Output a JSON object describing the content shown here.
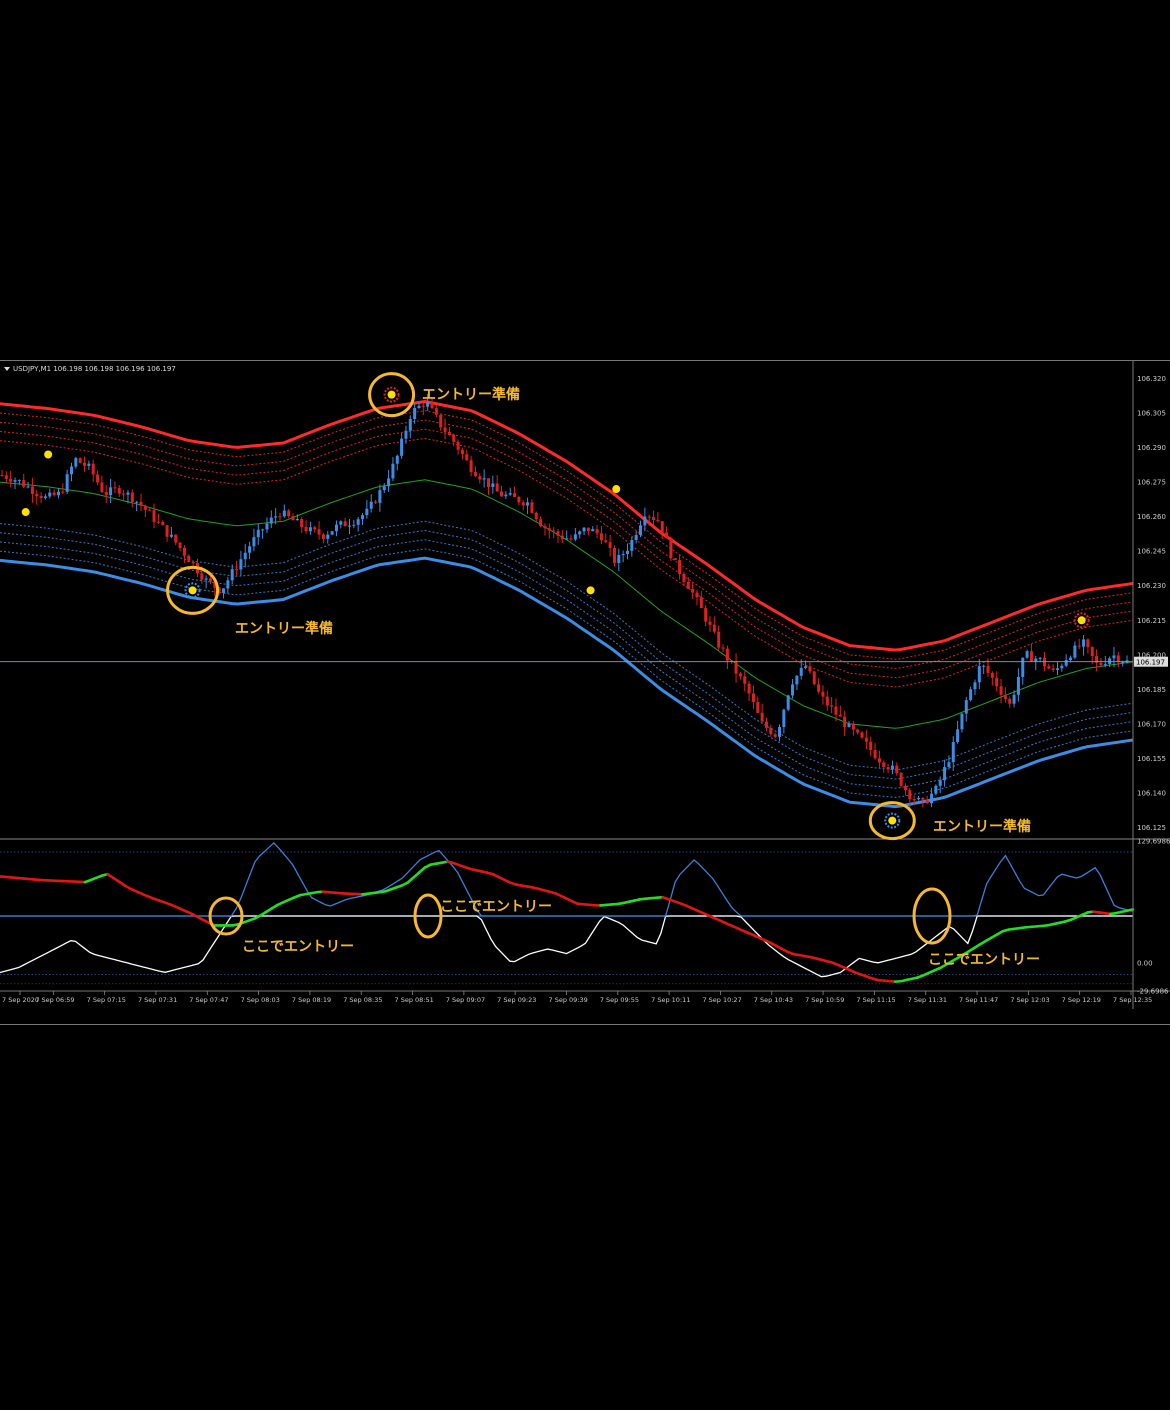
{
  "window": {
    "symbol": "USDJPY,M1",
    "ohlc": "106.198 106.198 106.196 106.197"
  },
  "colors": {
    "up": "#3a8ee6",
    "down": "#e02020",
    "band_upper": "#ff2a2a",
    "band_lower": "#3a8ee6",
    "midline": "#1fa11f",
    "signal_dot": "#ffe000",
    "annotation": "#f5b82e",
    "osc_white": "#ffffff",
    "osc_blue": "#3a7fd8",
    "osc_green": "#22dd22",
    "osc_red": "#e01515"
  },
  "chart_data": [
    {
      "type": "candlestick",
      "symbol": "USDJPY",
      "timeframe": "M1",
      "price_axis_labels": [
        "106.320",
        "106.305",
        "106.290",
        "106.275",
        "106.260",
        "106.245",
        "106.230",
        "106.215",
        "106.200",
        "106.185",
        "106.170",
        "106.155",
        "106.140",
        "106.125"
      ],
      "current_price": "106.197",
      "ylim": [
        106.12,
        106.325
      ],
      "annotations": [
        "エントリー準備",
        "エントリー準備",
        "エントリー準備"
      ],
      "signal_dots": [
        {
          "time": "06:55",
          "price": 106.262,
          "kind": "yellow"
        },
        {
          "time": "07:02",
          "price": 106.287,
          "kind": "yellow"
        },
        {
          "time": "07:47",
          "price": 106.228,
          "kind": "buy"
        },
        {
          "time": "08:49",
          "price": 106.313,
          "kind": "sell"
        },
        {
          "time": "09:51",
          "price": 106.228,
          "kind": "yellow"
        },
        {
          "time": "09:59",
          "price": 106.272,
          "kind": "yellow"
        },
        {
          "time": "11:25",
          "price": 106.128,
          "kind": "buy"
        },
        {
          "time": "12:24",
          "price": 106.215,
          "kind": "sell"
        }
      ],
      "series": [
        {
          "name": "close",
          "values": [
            106.278,
            106.276,
            106.272,
            106.268,
            106.27,
            106.285,
            106.281,
            106.27,
            106.272,
            106.268,
            106.262,
            106.255,
            106.248,
            106.24,
            106.232,
            106.228,
            106.238,
            106.248,
            106.256,
            106.262,
            106.258,
            106.254,
            106.252,
            106.256,
            106.258,
            106.262,
            106.272,
            106.285,
            106.305,
            106.31,
            106.3,
            106.292,
            106.282,
            106.276,
            106.27,
            106.268,
            106.266,
            106.256,
            106.252,
            106.25,
            106.255,
            106.252,
            106.24,
            106.248,
            106.262,
            106.258,
            106.24,
            106.23,
            106.218,
            106.205,
            106.195,
            106.185,
            106.17,
            106.165,
            106.188,
            106.195,
            106.182,
            106.175,
            106.168,
            106.162,
            106.155,
            106.15,
            106.14,
            106.135,
            106.142,
            106.158,
            106.18,
            106.196,
            106.188,
            106.178,
            106.2,
            106.198,
            106.192,
            106.2,
            106.205,
            106.195,
            106.2,
            106.197
          ]
        },
        {
          "name": "midline",
          "values": [
            106.275,
            106.273,
            106.27,
            106.265,
            106.259,
            106.256,
            106.258,
            106.266,
            106.273,
            106.276,
            106.272,
            106.262,
            106.25,
            106.236,
            106.219,
            106.205,
            106.19,
            106.178,
            106.17,
            106.168,
            106.172,
            106.18,
            106.188,
            106.194,
            106.197
          ]
        }
      ]
    },
    {
      "type": "line",
      "panel": "oscillator",
      "axis_labels": [
        "129.6986",
        "0.00",
        "-29.6986"
      ],
      "ylim": [
        -29.6986,
        129.6986
      ],
      "annotations": [
        "ここでエントリー",
        "ここでエントリー",
        "ここでエントリー"
      ],
      "x_labels": [
        "7 Sep 2020",
        "7 Sep 06:59",
        "7 Sep 07:15",
        "7 Sep 07:31",
        "7 Sep 07:47",
        "7 Sep 08:03",
        "7 Sep 08:19",
        "7 Sep 08:35",
        "7 Sep 08:51",
        "7 Sep 09:07",
        "7 Sep 09:23",
        "7 Sep 09:39",
        "7 Sep 09:55",
        "7 Sep 10:11",
        "7 Sep 10:27",
        "7 Sep 10:43",
        "7 Sep 10:59",
        "7 Sep 11:15",
        "7 Sep 11:31",
        "7 Sep 11:47",
        "7 Sep 12:03",
        "7 Sep 12:19",
        "7 Sep 12:35"
      ],
      "series": [
        {
          "name": "fast",
          "values": [
            -10,
            -5,
            5,
            15,
            25,
            10,
            5,
            0,
            -5,
            -10,
            -5,
            0,
            30,
            60,
            110,
            128,
            105,
            70,
            60,
            68,
            72,
            78,
            90,
            110,
            120,
            98,
            60,
            20,
            0,
            10,
            15,
            10,
            20,
            50,
            42,
            25,
            20,
            90,
            110,
            90,
            60,
            40,
            20,
            5,
            -5,
            -15,
            -10,
            5,
            0,
            5,
            10,
            25,
            40,
            20,
            85,
            115,
            80,
            70,
            95,
            90,
            102,
            60,
            55
          ]
        },
        {
          "name": "signal",
          "values": [
            92,
            90,
            88,
            87,
            86,
            95,
            80,
            70,
            62,
            52,
            40,
            40,
            48,
            62,
            72,
            76,
            74,
            73,
            76,
            84,
            104,
            108,
            100,
            95,
            84,
            80,
            74,
            63,
            61,
            63,
            68,
            70,
            62,
            52,
            42,
            32,
            22,
            10,
            6,
            0,
            -10,
            -18,
            -20,
            -15,
            -5,
            8,
            22,
            35,
            38,
            40,
            45,
            55,
            52,
            57
          ]
        }
      ]
    }
  ]
}
